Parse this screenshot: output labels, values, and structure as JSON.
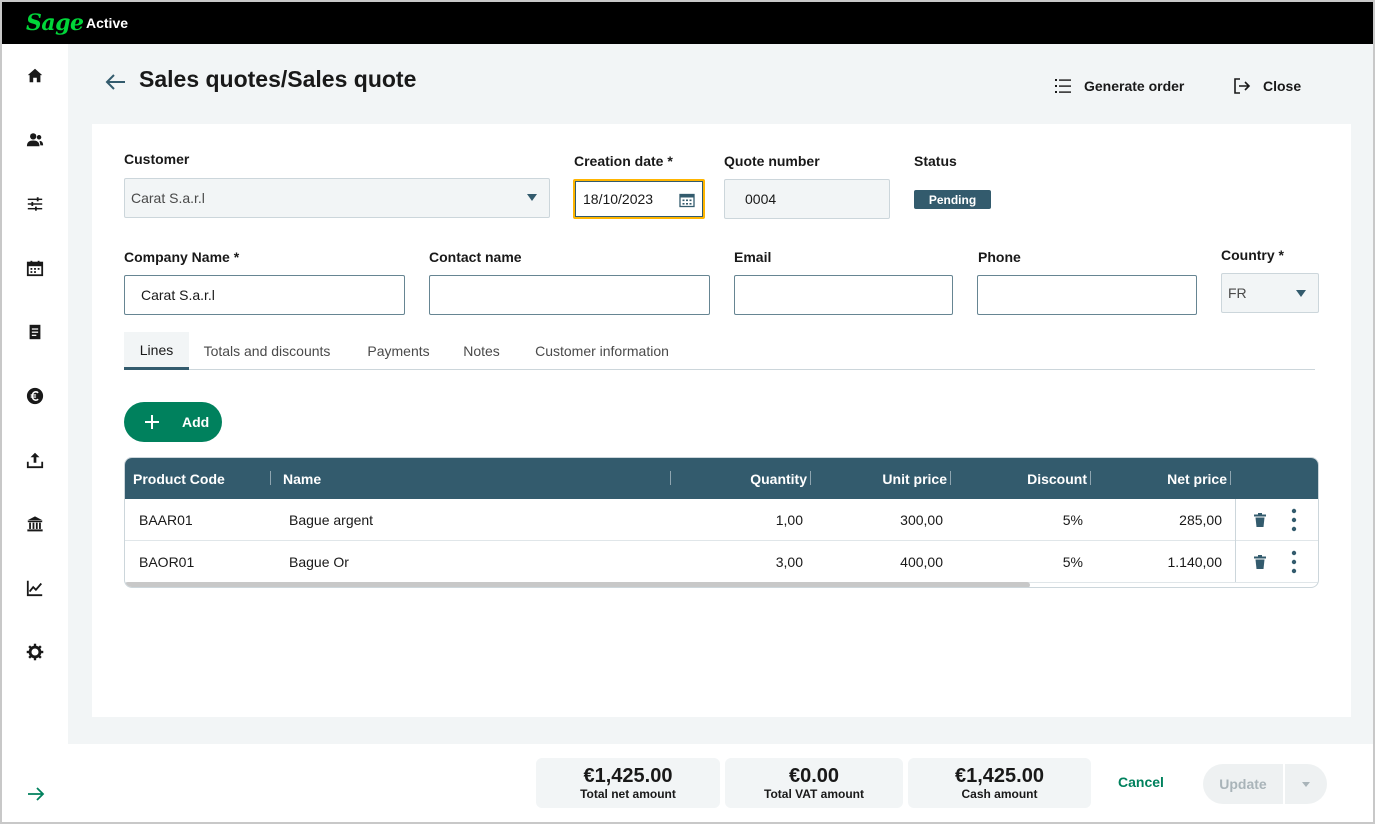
{
  "brand": {
    "logo": "Sage",
    "app_name": "Active"
  },
  "sidebar": {
    "items": [
      {
        "icon": "home-icon"
      },
      {
        "icon": "contacts-icon"
      },
      {
        "icon": "settings-sliders-icon"
      },
      {
        "icon": "calendar-icon"
      },
      {
        "icon": "document-icon"
      },
      {
        "icon": "euro-icon"
      },
      {
        "icon": "upload-icon"
      },
      {
        "icon": "bank-icon"
      },
      {
        "icon": "chart-line-icon"
      },
      {
        "icon": "gear-icon"
      }
    ],
    "expand_icon": "arrow-right-icon"
  },
  "header": {
    "title": "Sales quotes/Sales quote",
    "generate_order": "Generate order",
    "close": "Close"
  },
  "form": {
    "customer": {
      "label": "Customer",
      "value": "Carat S.a.r.l"
    },
    "creation_date": {
      "label": "Creation date *",
      "value": "18/10/2023"
    },
    "quote_number": {
      "label": "Quote number",
      "value": "0004"
    },
    "status": {
      "label": "Status",
      "value": "Pending"
    },
    "company_name": {
      "label": "Company Name *",
      "value": "Carat S.a.r.l"
    },
    "contact_name": {
      "label": "Contact name",
      "value": ""
    },
    "email": {
      "label": "Email",
      "value": ""
    },
    "phone": {
      "label": "Phone",
      "value": ""
    },
    "country": {
      "label": "Country *",
      "value": "FR"
    }
  },
  "tabs": [
    {
      "label": "Lines",
      "active": true
    },
    {
      "label": "Totals and discounts",
      "active": false
    },
    {
      "label": "Payments",
      "active": false
    },
    {
      "label": "Notes",
      "active": false
    },
    {
      "label": "Customer information",
      "active": false
    }
  ],
  "add_button": "Add",
  "table": {
    "columns": [
      "Product Code",
      "Name",
      "Quantity",
      "Unit price",
      "Discount",
      "Net price"
    ],
    "rows": [
      {
        "code": "BAAR01",
        "name": "Bague argent",
        "quantity": "1,00",
        "unit_price": "300,00",
        "discount": "5%",
        "net_price": "285,00"
      },
      {
        "code": "BAOR01",
        "name": "Bague Or",
        "quantity": "3,00",
        "unit_price": "400,00",
        "discount": "5%",
        "net_price": "1.140,00"
      }
    ]
  },
  "totals": {
    "net": {
      "value": "€1,425.00",
      "label": "Total net amount"
    },
    "vat": {
      "value": "€0.00",
      "label": "Total VAT amount"
    },
    "cash": {
      "value": "€1,425.00",
      "label": "Cash amount"
    }
  },
  "footer": {
    "cancel": "Cancel",
    "update": "Update"
  },
  "colors": {
    "brand_green": "#00d639",
    "action_green": "#00815d",
    "header_blue": "#335b6d",
    "focus_yellow": "#ffb500"
  }
}
